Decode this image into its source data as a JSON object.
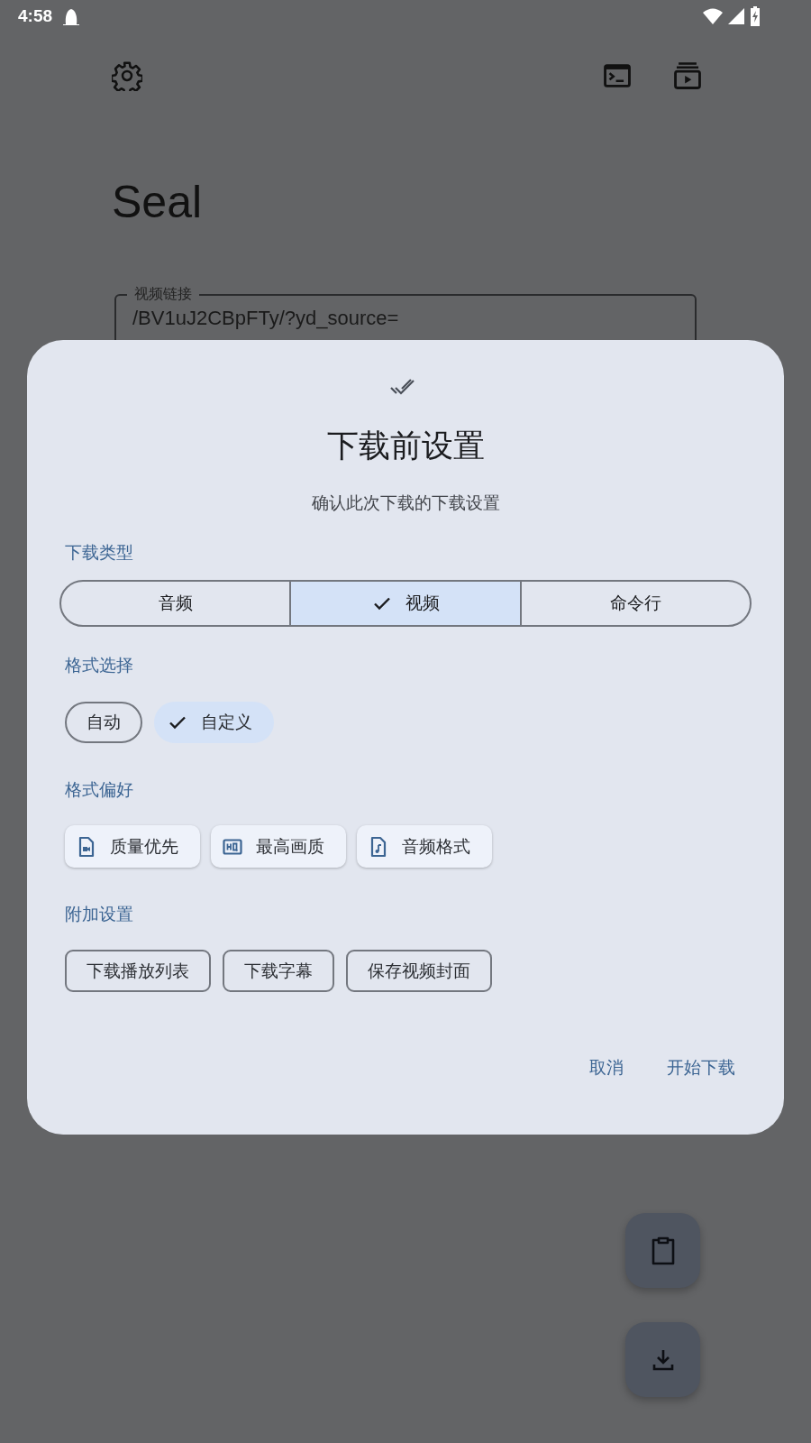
{
  "status_bar": {
    "time": "4:58"
  },
  "title": "Seal",
  "url_field": {
    "label": "视频链接",
    "value": "/BV1uJ2CBpFTy/?yd_source="
  },
  "dialog": {
    "title": "下载前设置",
    "subtitle": "确认此次下载的下载设置",
    "sections": [
      {
        "kind": "segmented",
        "label": "下载类型",
        "options": [
          {
            "label": "音频",
            "selected": false
          },
          {
            "label": "视频",
            "selected": true
          },
          {
            "label": "命令行",
            "selected": false
          }
        ]
      },
      {
        "kind": "filter",
        "label": "格式选择",
        "chips": [
          {
            "label": "自动",
            "selected": false
          },
          {
            "label": "自定义",
            "selected": true
          }
        ]
      },
      {
        "kind": "assist",
        "label": "格式偏好",
        "chips": [
          {
            "label": "质量优先",
            "kind": "video"
          },
          {
            "label": "最高画质",
            "kind": "hd"
          },
          {
            "label": "音频格式",
            "kind": "audio"
          }
        ]
      },
      {
        "kind": "outlined",
        "label": "附加设置",
        "chips": [
          {
            "label": "下载播放列表",
            "selected": false
          },
          {
            "label": "下载字幕",
            "selected": false
          },
          {
            "label": "保存视频封面",
            "selected": false
          }
        ]
      }
    ],
    "buttons": [
      {
        "label": "取消"
      },
      {
        "label": "开始下载"
      }
    ]
  }
}
